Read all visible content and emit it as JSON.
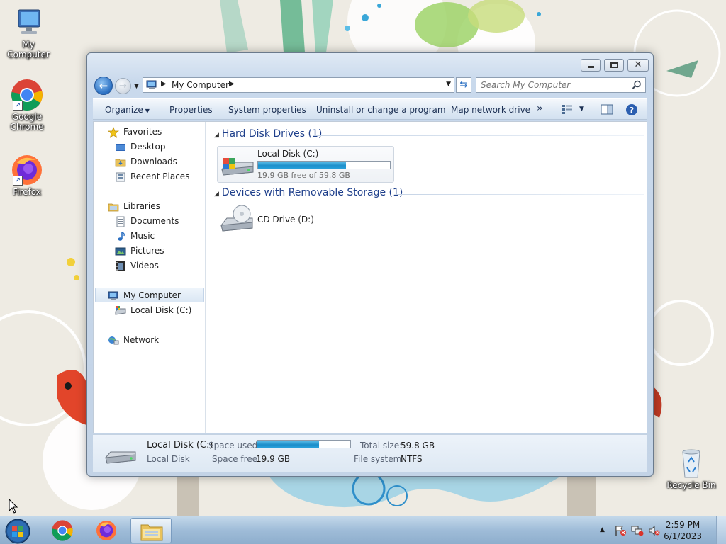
{
  "desktop": {
    "icons": [
      {
        "label": "My Computer"
      },
      {
        "label": "Google Chrome"
      },
      {
        "label": "Firefox"
      },
      {
        "label": "Recycle Bin"
      }
    ]
  },
  "window": {
    "address": {
      "crumb": "My Computer"
    },
    "search": {
      "placeholder": "Search My Computer"
    },
    "toolbar": {
      "organize": "Organize",
      "properties": "Properties",
      "system_properties": "System properties",
      "uninstall": "Uninstall or change a program",
      "map_drive": "Map network drive",
      "more": "»"
    },
    "nav": {
      "favorites": "Favorites",
      "desktop": "Desktop",
      "downloads": "Downloads",
      "recent": "Recent Places",
      "libraries": "Libraries",
      "documents": "Documents",
      "music": "Music",
      "pictures": "Pictures",
      "videos": "Videos",
      "my_computer": "My Computer",
      "local_disk": "Local Disk (C:)",
      "network": "Network"
    },
    "groups": {
      "hdd": "Hard Disk Drives (1)",
      "removable": "Devices with Removable Storage (1)"
    },
    "drives": {
      "c_name": "Local Disk (C:)",
      "c_free": "19.9 GB free of 59.8 GB",
      "c_used_fraction": 0.667,
      "d_name": "CD Drive (D:)"
    },
    "details": {
      "name": "Local Disk (C:)",
      "type": "Local Disk",
      "space_used_label": "Space used:",
      "space_free_label": "Space free:",
      "space_free": "19.9 GB",
      "total_size_label": "Total size:",
      "total_size": "59.8 GB",
      "fs_label": "File system:",
      "fs": "NTFS"
    }
  },
  "taskbar": {
    "time": "2:59 PM",
    "date": "6/1/2023"
  }
}
